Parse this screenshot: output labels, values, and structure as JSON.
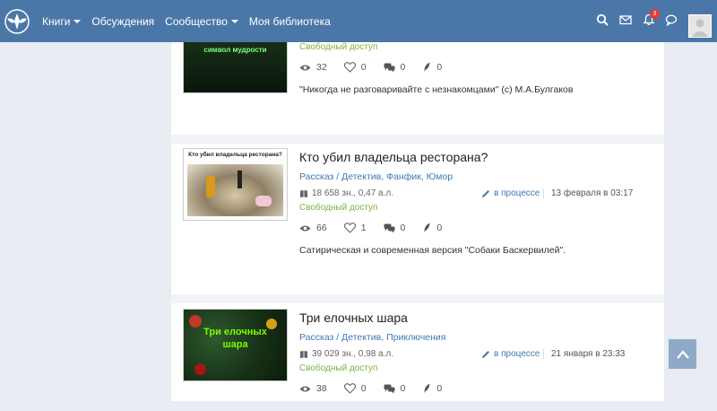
{
  "header": {
    "nav": [
      {
        "label": "Книги",
        "has_dropdown": true
      },
      {
        "label": "Обсуждения",
        "has_dropdown": false
      },
      {
        "label": "Сообщество",
        "has_dropdown": true
      },
      {
        "label": "Моя библиотека",
        "has_dropdown": false
      }
    ],
    "icons": [
      "search-icon",
      "mail-icon",
      "bell-icon",
      "chat-icon"
    ],
    "notifications_count": "3"
  },
  "books": [
    {
      "cover_text": "символ мудрости",
      "access": "Свободный доступ",
      "views": "32",
      "likes": "0",
      "comments": "0",
      "reviews": "0",
      "description": "\"Никогда не разговаривайте с незнакомцами\" (с) М.А.Булгаков"
    },
    {
      "cover_text": "Кто убил владельца ресторана?",
      "title": "Кто убил владельца ресторана?",
      "genre": "Рассказ",
      "tags": [
        "Детектив",
        "Фанфик",
        "Юмор"
      ],
      "size": "18 658 зн., 0,47 а.л.",
      "status": "в процессе",
      "date": "13 февраля в 03:17",
      "access": "Свободный доступ",
      "views": "66",
      "likes": "1",
      "comments": "0",
      "reviews": "0",
      "description": "Сатирическая и современная версия \"Собаки Баскервилей\"."
    },
    {
      "cover_text": "Три елочных шара",
      "title": "Три елочных шара",
      "genre": "Рассказ",
      "tags": [
        "Детектив",
        "Приключения"
      ],
      "size": "39 029 зн., 0,98 а.л.",
      "status": "в процессе",
      "date": "21 января в 23:33",
      "access": "Свободный доступ",
      "views": "38",
      "likes": "0",
      "comments": "0",
      "reviews": "0"
    }
  ],
  "colors": {
    "header_bg": "#4a77a8",
    "link": "#3f79b4",
    "free_access": "#7cb342",
    "page_bg": "#e9ecf3"
  }
}
